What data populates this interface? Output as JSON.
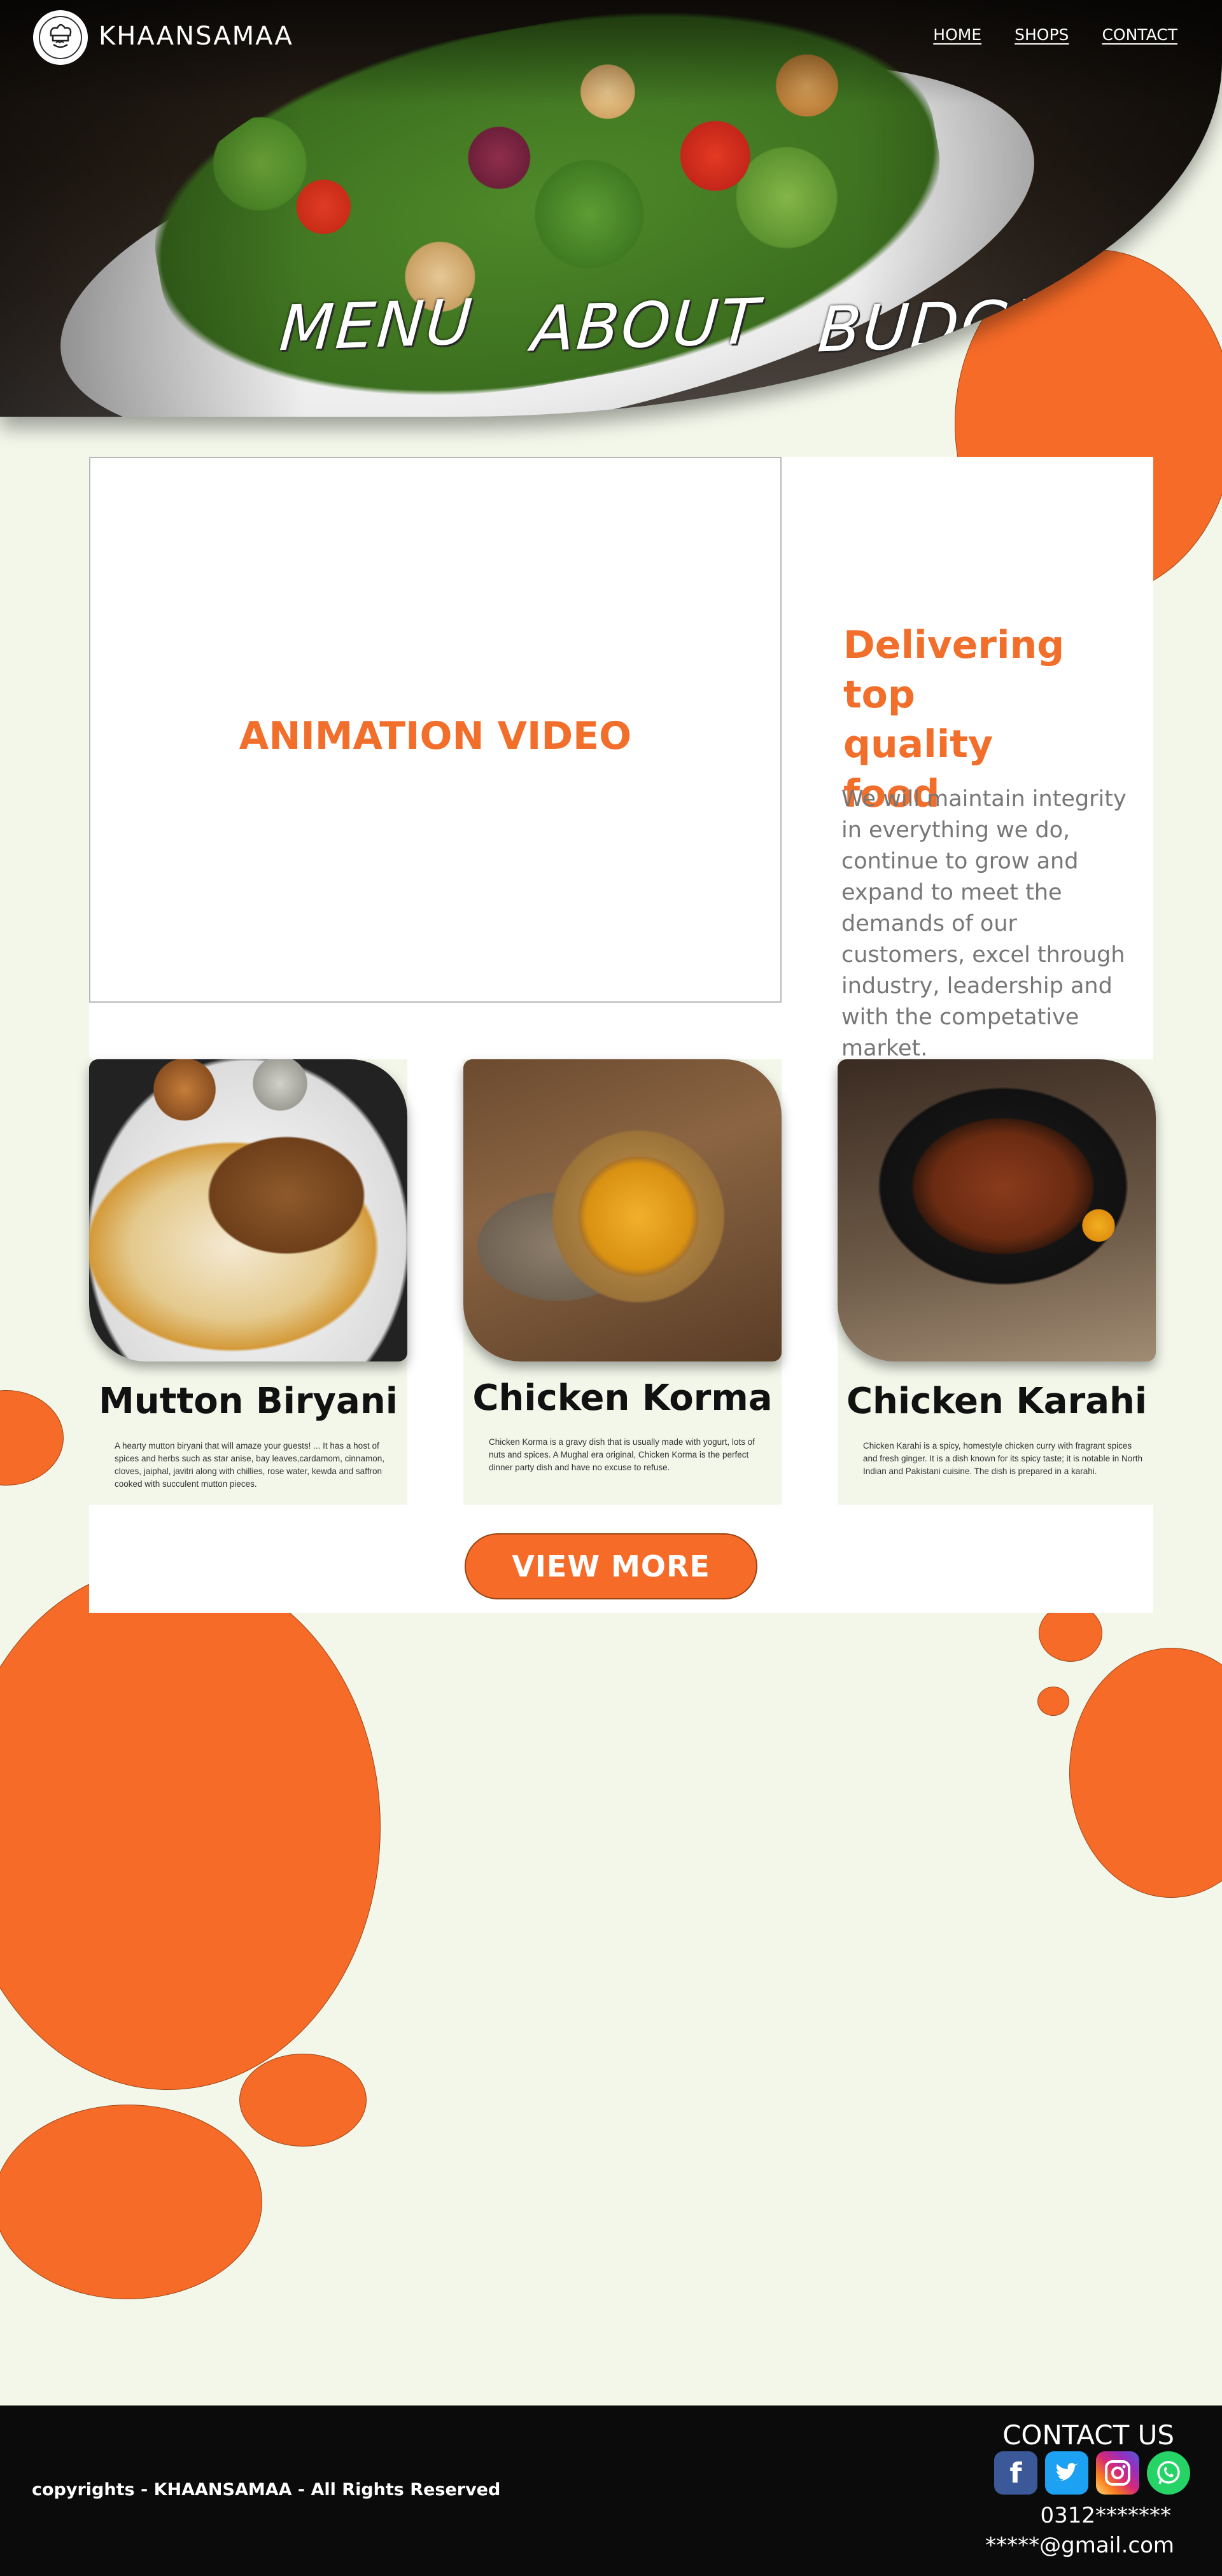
{
  "header": {
    "brand": "KHAANSAMAA",
    "logo_icon": "chef-hat-icon",
    "nav": [
      "HOME",
      "SHOPS",
      "CONTACT"
    ],
    "hero_menu": [
      "MENU",
      "ABOUT",
      "BUDGET"
    ]
  },
  "main": {
    "video_label": "ANIMATION VIDEO",
    "delivering_title": "Delivering top quality food",
    "delivering_text": "We will maintain integrity in everything we do, continue to grow and expand to meet the demands of our customers, excel through industry, leadership and with the competative market.",
    "dishes": [
      {
        "name": "Mutton Biryani",
        "desc": "A hearty mutton biryani that will amaze your guests! ... It has a host of spices and herbs such as star anise, bay leaves,cardamom, cinnamon, cloves, jaiphal, javitri along with chillies, rose water, kewda and saffron cooked with succulent mutton pieces."
      },
      {
        "name": "Chicken Korma",
        "desc": "Chicken Korma is a gravy dish that is usually made with yogurt, lots of nuts and spices. A Mughal era original, Chicken Korma is the perfect dinner party dish and have no excuse to refuse."
      },
      {
        "name": "Chicken Karahi",
        "desc": "Chicken Karahi  is a spicy, homestyle chicken curry with fragrant spices and fresh ginger. It is a dish known for its spicy taste; it is notable in North Indian and Pakistani cuisine. The dish is prepared in a karahi."
      }
    ],
    "view_more": "VIEW MORE"
  },
  "footer": {
    "copyright": "copyrights - KHAANSAMAA - All Rights Reserved",
    "contact_title": "CONTACT US",
    "social_icons": [
      "facebook-icon",
      "twitter-icon",
      "instagram-icon",
      "whatsapp-icon"
    ],
    "phone": "0312*******",
    "email": "*****@gmail.com"
  },
  "colors": {
    "accent": "#f76b28",
    "title_orange": "#f26e2b",
    "background": "#f3f7ea",
    "footer": "#0b0b0b"
  }
}
